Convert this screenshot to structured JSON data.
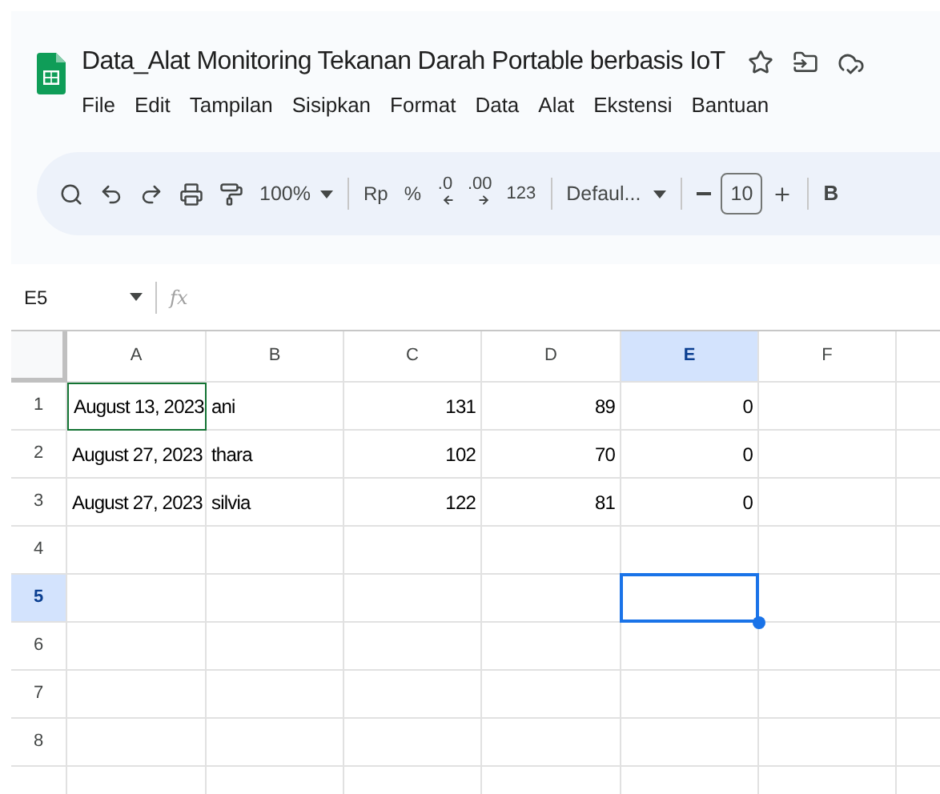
{
  "document": {
    "title": "Data_Alat Monitoring Tekanan Darah Portable berbasis IoT",
    "starred": false
  },
  "menu": [
    "File",
    "Edit",
    "Tampilan",
    "Sisipkan",
    "Format",
    "Data",
    "Alat",
    "Ekstensi",
    "Bantuan"
  ],
  "toolbar": {
    "zoom": "100%",
    "currency": "Rp",
    "percent": "%",
    "decrease_decimal": ".0",
    "increase_decimal": ".00",
    "number_format": "123",
    "font": "Defaul...",
    "font_size": "10",
    "bold": "B"
  },
  "formula_bar": {
    "cell_ref": "E5",
    "fx": "fx"
  },
  "grid": {
    "columns": [
      {
        "label": "A",
        "selected": false
      },
      {
        "label": "B",
        "selected": false
      },
      {
        "label": "C",
        "selected": false
      },
      {
        "label": "D",
        "selected": false
      },
      {
        "label": "E",
        "selected": true
      },
      {
        "label": "F",
        "selected": false
      }
    ],
    "rows": [
      {
        "label": "1",
        "selected": false,
        "cells": [
          {
            "text": "August 13, 2023",
            "kind": "text",
            "outlined": true
          },
          {
            "text": "ani",
            "kind": "text",
            "outlined": false
          },
          {
            "text": "131",
            "kind": "number",
            "outlined": false
          },
          {
            "text": "89",
            "kind": "number",
            "outlined": false
          },
          {
            "text": "0",
            "kind": "number",
            "outlined": false
          }
        ]
      },
      {
        "label": "2",
        "selected": false,
        "cells": [
          {
            "text": "August 27, 2023",
            "kind": "text",
            "outlined": false
          },
          {
            "text": "thara",
            "kind": "text",
            "outlined": false
          },
          {
            "text": "102",
            "kind": "number",
            "outlined": false
          },
          {
            "text": "70",
            "kind": "number",
            "outlined": false
          },
          {
            "text": "0",
            "kind": "number",
            "outlined": false
          }
        ]
      },
      {
        "label": "3",
        "selected": false,
        "cells": [
          {
            "text": "August 27, 2023",
            "kind": "text",
            "outlined": false
          },
          {
            "text": "silvia",
            "kind": "text",
            "outlined": false
          },
          {
            "text": "122",
            "kind": "number",
            "outlined": false
          },
          {
            "text": "81",
            "kind": "number",
            "outlined": false
          },
          {
            "text": "0",
            "kind": "number",
            "outlined": false
          }
        ]
      },
      {
        "label": "4",
        "selected": false
      },
      {
        "label": "5",
        "selected": true
      },
      {
        "label": "6",
        "selected": false
      },
      {
        "label": "7",
        "selected": false
      },
      {
        "label": "8",
        "selected": false
      }
    ]
  }
}
